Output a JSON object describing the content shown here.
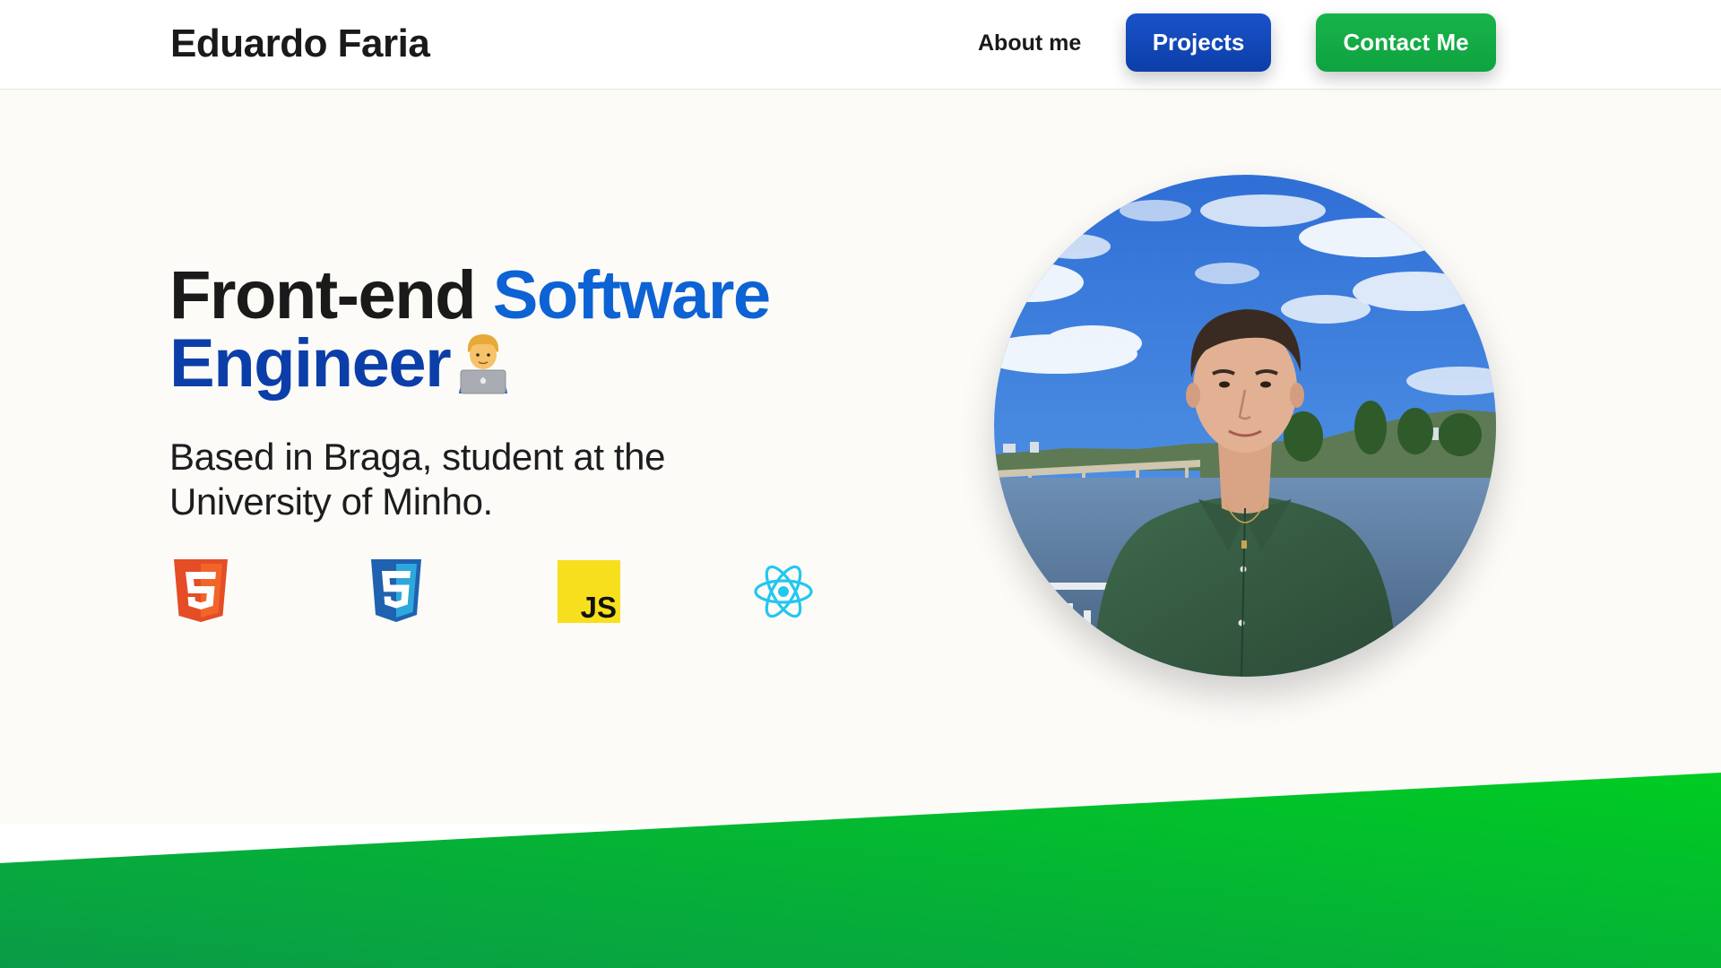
{
  "header": {
    "brand": "Eduardo Faria",
    "nav": {
      "about": "About me",
      "projects": "Projects",
      "contact": "Contact Me"
    }
  },
  "hero": {
    "headline": {
      "part1": "Front-end",
      "part2": "Software",
      "part3": "Engineer",
      "emoji": "man-technologist-emoji"
    },
    "subtitle": "Based in Braga, student at the University of Minho.",
    "tech_icons": [
      "html5-icon",
      "css3-icon",
      "javascript-icon",
      "react-icon"
    ],
    "avatar_alt": "profile-photo"
  },
  "colors": {
    "accent_blue": "#0d62d4",
    "accent_dark_blue": "#0b3ea8",
    "projects_button": "#0b3ea8",
    "contact_button": "#12a845",
    "band_green_start": "#0a9b48",
    "band_green_end": "#00cc22",
    "page_background": "#fcfbf8"
  }
}
